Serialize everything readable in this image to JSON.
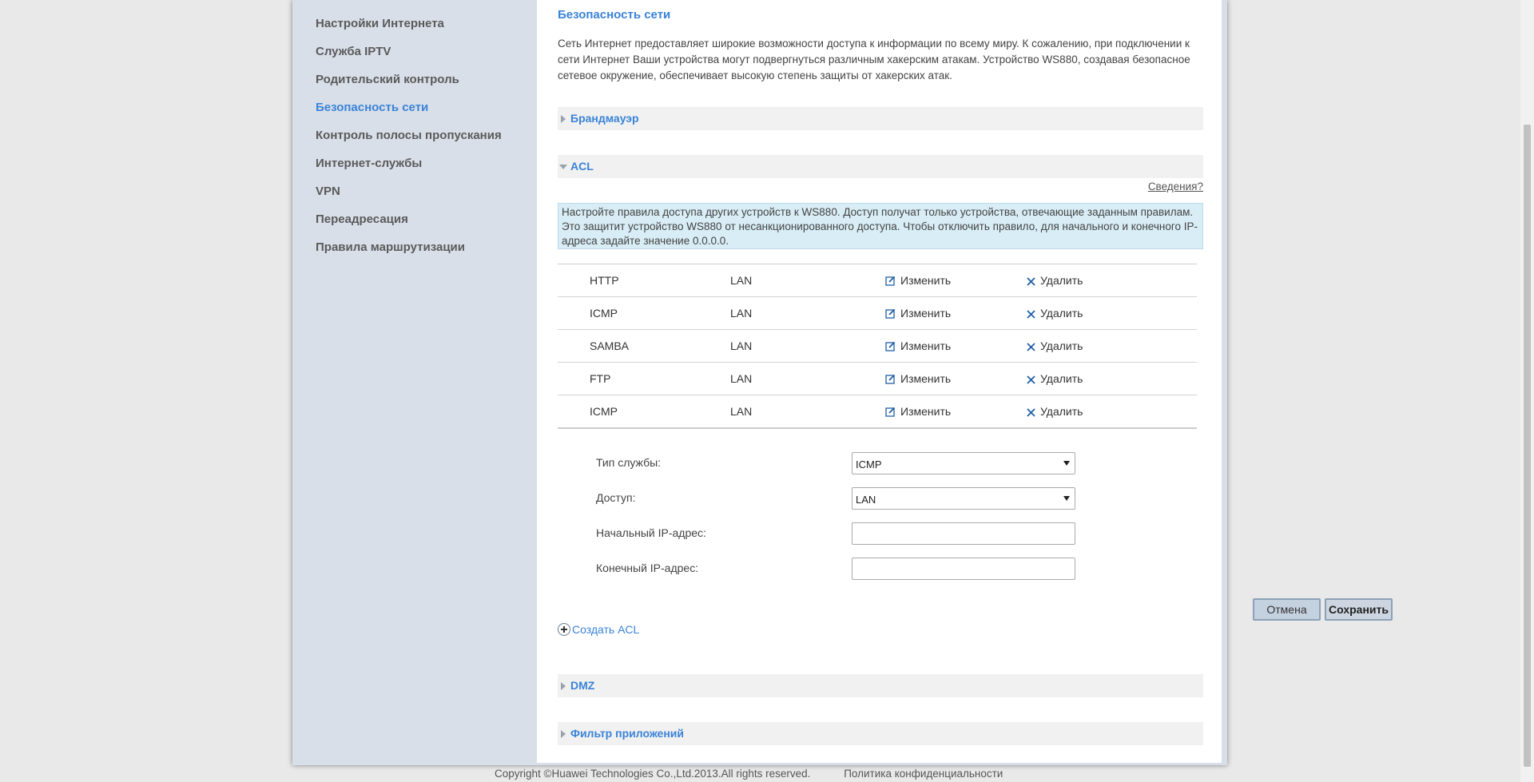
{
  "sidebar": {
    "items": [
      {
        "label": "Настройки Интернета"
      },
      {
        "label": "Служба IPTV"
      },
      {
        "label": "Родительский контроль"
      },
      {
        "label": "Безопасность сети"
      },
      {
        "label": "Контроль полосы пропускания"
      },
      {
        "label": "Интернет-службы"
      },
      {
        "label": "VPN"
      },
      {
        "label": "Переадресация"
      },
      {
        "label": "Правила маршрутизации"
      }
    ],
    "active_label": "Безопасность сети"
  },
  "main": {
    "title": "Безопасность сети",
    "intro": "Сеть Интернет предоставляет широкие возможности доступа к информации по всему миру. К сожалению, при подключении к сети Интернет Ваши устройства могут подвергнуться различным хакерским атакам. Устройство WS880, создавая безопасное сетевое окружение, обеспечивает высокую степень защиты от хакерских атак.",
    "sections": {
      "firewall": "Брандмауэр",
      "acl": "ACL",
      "dmz": "DMZ",
      "app_filter": "Фильтр приложений"
    },
    "acl": {
      "help_link": "Сведения?",
      "note": "Настройте правила доступа других устройств к WS880. Доступ получат только устройства, отвечающие заданным правилам. Это защитит устройство WS880 от несанкционированного доступа. Чтобы отключить правило, для начального и конечного IP-адреса задайте значение 0.0.0.0.",
      "rows": [
        {
          "service": "HTTP",
          "access": "LAN",
          "edit": "Изменить",
          "delete": "Удалить"
        },
        {
          "service": "ICMP",
          "access": "LAN",
          "edit": "Изменить",
          "delete": "Удалить"
        },
        {
          "service": "SAMBA",
          "access": "LAN",
          "edit": "Изменить",
          "delete": "Удалить"
        },
        {
          "service": "FTP",
          "access": "LAN",
          "edit": "Изменить",
          "delete": "Удалить"
        },
        {
          "service": "ICMP",
          "access": "LAN",
          "edit": "Изменить",
          "delete": "Удалить"
        }
      ],
      "form": {
        "service_type_label": "Тип службы:",
        "service_type_value": "ICMP",
        "access_label": "Доступ:",
        "access_value": "LAN",
        "start_ip_label": "Начальный IP-адрес:",
        "start_ip_value": "",
        "end_ip_label": "Конечный IP-адрес:",
        "end_ip_value": "",
        "cancel": "Отмена",
        "save": "Сохранить"
      },
      "create_label": "Создать ACL"
    }
  },
  "footer": {
    "copyright": "Copyright ©Huawei Technologies Co.,Ltd.2013.All rights reserved.",
    "privacy": "Политика конфиденциальности"
  },
  "colors": {
    "accent": "#3a83d8",
    "sidebar_bg": "#d9dfe9",
    "note_bg": "#d8edf5",
    "icon_blue": "#1f5fa8"
  }
}
